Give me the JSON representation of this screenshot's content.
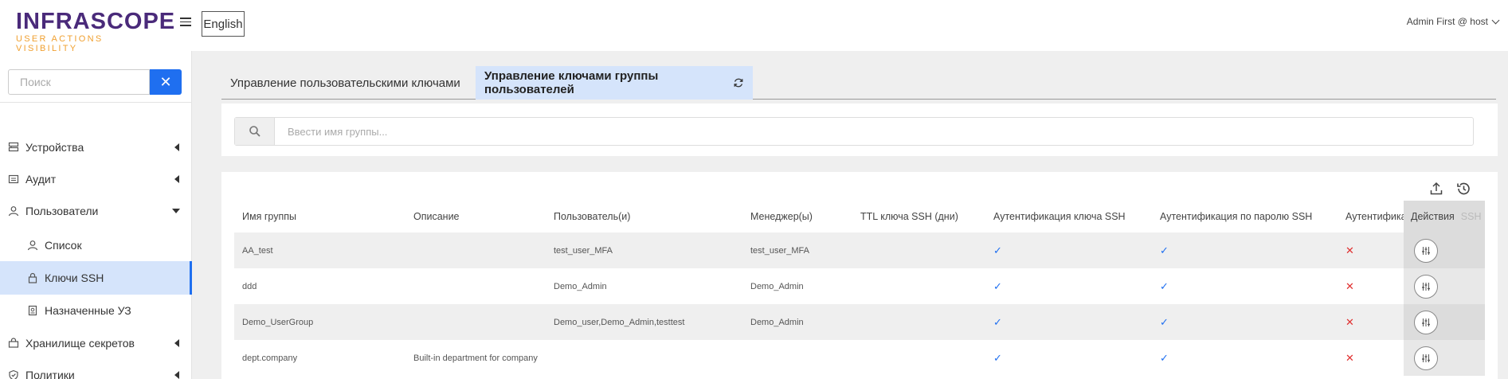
{
  "header": {
    "logo_main": "INFRASCOPE",
    "logo_sub": "USER ACTIONS VISIBILITY",
    "language": "English",
    "user": "Admin First @ host"
  },
  "sidebar": {
    "search_placeholder": "Поиск",
    "search_clear": "✕",
    "items": [
      {
        "label": "Устройства",
        "icon": "server-icon"
      },
      {
        "label": "Аудит",
        "icon": "audit-icon"
      },
      {
        "label": "Пользователи",
        "icon": "user-icon"
      },
      {
        "label": "Список",
        "icon": "user-icon"
      },
      {
        "label": "Ключи SSH",
        "icon": "lock-icon"
      },
      {
        "label": "Назначенные УЗ",
        "icon": "document-icon"
      },
      {
        "label": "Хранилище секретов",
        "icon": "vault-icon"
      },
      {
        "label": "Политики",
        "icon": "shield-icon"
      }
    ]
  },
  "tabs": [
    {
      "label": "Управление пользовательскими ключами"
    },
    {
      "label": "Управление ключами группы пользователей"
    }
  ],
  "filter": {
    "placeholder": "Ввести имя группы..."
  },
  "table": {
    "columns": [
      "Имя группы",
      "Описание",
      "Пользователь(и)",
      "Менеджер(ы)",
      "TTL ключа SSH (дни)",
      "Аутентификация ключа SSH",
      "Аутентификация по паролю SSH",
      "Аутентифика",
      "Действия",
      "SSH"
    ],
    "rows": [
      {
        "name": "AA_test",
        "description": "",
        "users": "test_user_MFA",
        "managers": "test_user_MFA",
        "ttl": "",
        "key_auth": "✓",
        "pass_auth": "✓",
        "other_auth": "✕"
      },
      {
        "name": "ddd",
        "description": "",
        "users": "Demo_Admin",
        "managers": "Demo_Admin",
        "ttl": "",
        "key_auth": "✓",
        "pass_auth": "✓",
        "other_auth": "✕"
      },
      {
        "name": "Demo_UserGroup",
        "description": "",
        "users": "Demo_user,Demo_Admin,testtest",
        "managers": "Demo_Admin",
        "ttl": "",
        "key_auth": "✓",
        "pass_auth": "✓",
        "other_auth": "✕"
      },
      {
        "name": "dept.company",
        "description": "Built-in department for company",
        "users": "",
        "managers": "",
        "ttl": "",
        "key_auth": "✓",
        "pass_auth": "✓",
        "other_auth": "✕"
      }
    ]
  },
  "colors": {
    "accent": "#1f6ff0",
    "active_bg": "#d5e4fb",
    "check": "#1f6ff0",
    "cross": "#e03030",
    "logo_main": "#4a2a7a",
    "logo_sub": "#f0a030"
  }
}
